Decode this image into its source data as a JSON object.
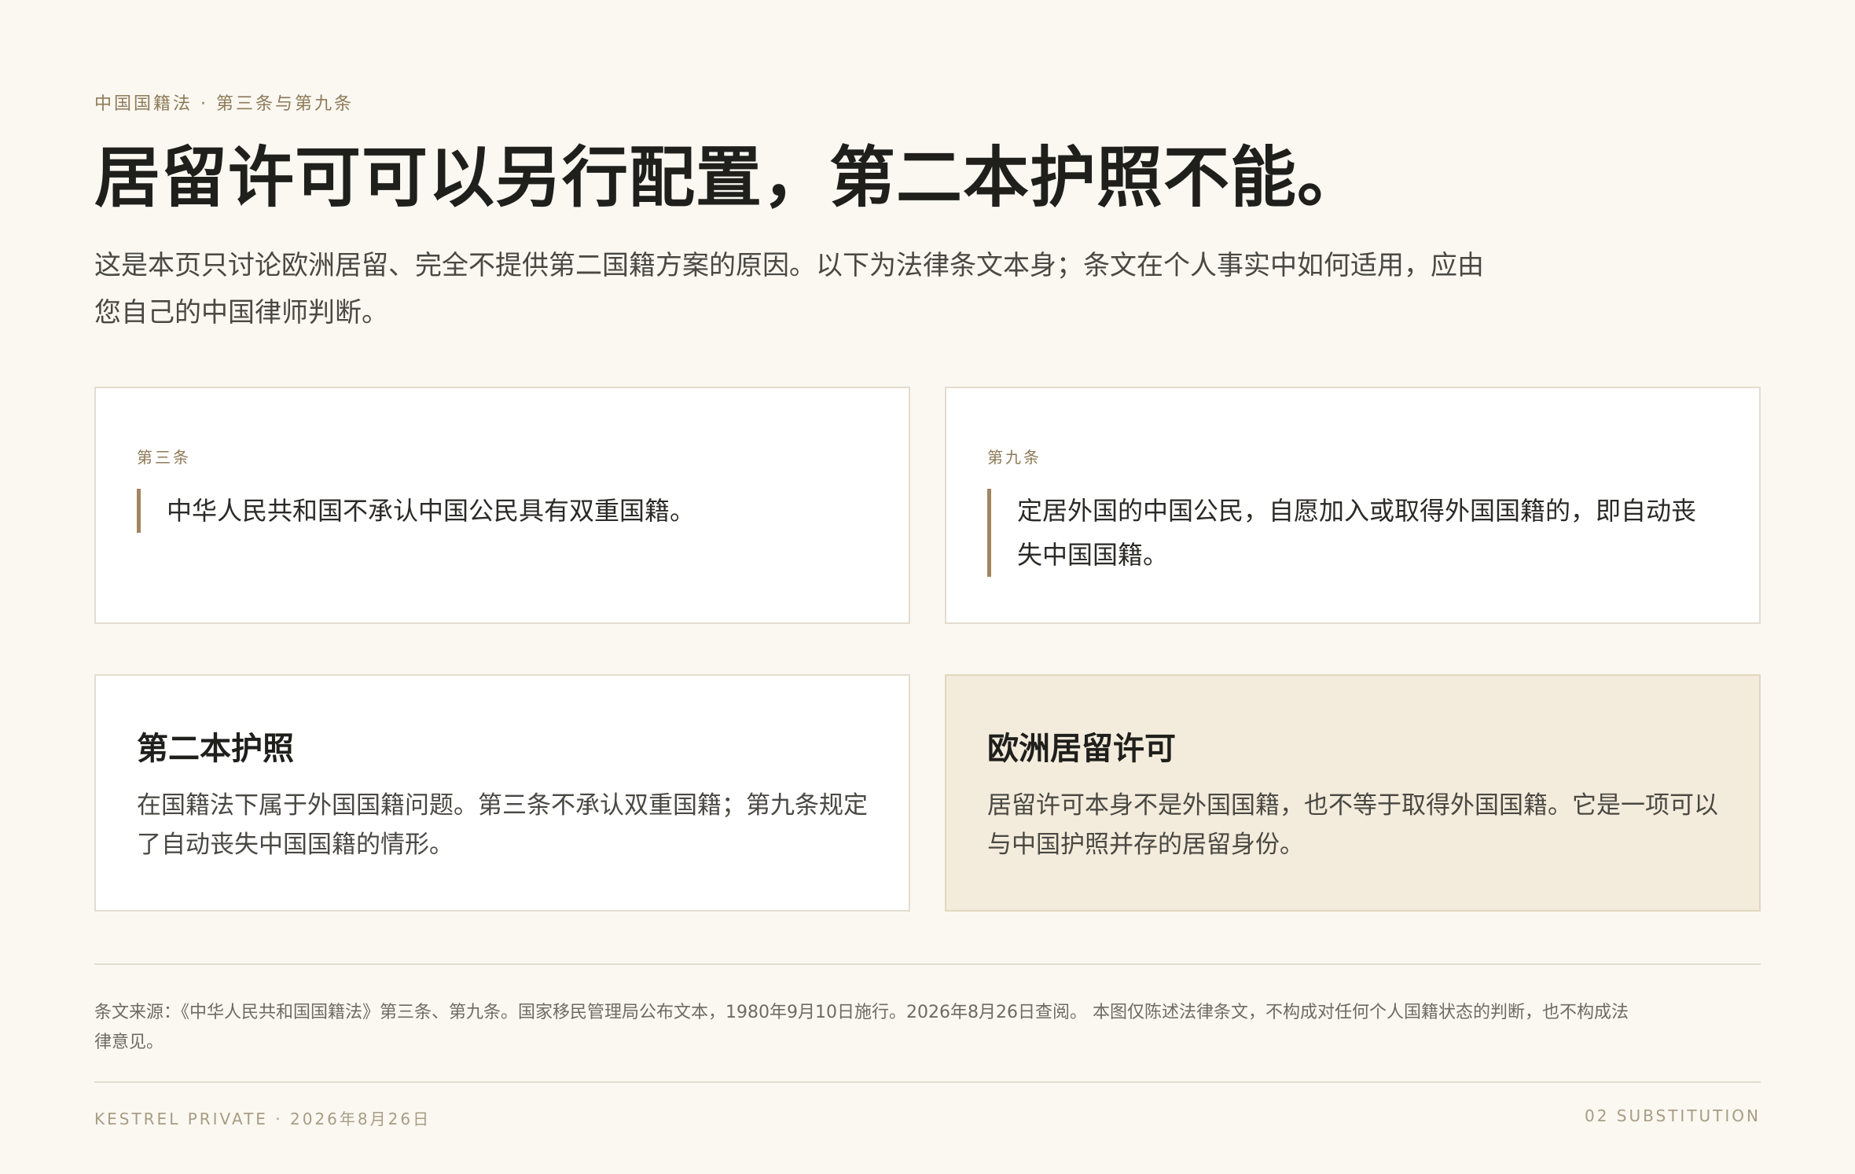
{
  "header": {
    "eyebrow": "中国国籍法 · 第三条与第九条",
    "title": "居留许可可以另行配置，第二本护照不能。",
    "lede": "这是本页只讨论欧洲居留、完全不提供第二国籍方案的原因。以下为法律条文本身；条文在个人事实中如何适用，应由您自己的中国律师判断。"
  },
  "articles": [
    {
      "label": "第三条",
      "text": "中华人民共和国不承认中国公民具有双重国籍。"
    },
    {
      "label": "第九条",
      "text": "定居外国的中国公民，自愿加入或取得外国国籍的，即自动丧失中国国籍。"
    }
  ],
  "comparison": [
    {
      "title": "第二本护照",
      "body": "在国籍法下属于外国国籍问题。第三条不承认双重国籍；第九条规定了自动丧失中国国籍的情形。"
    },
    {
      "title": "欧洲居留许可",
      "body": "居留许可本身不是外国国籍，也不等于取得外国国籍。它是一项可以与中国护照并存的居留身份。"
    }
  ],
  "source": {
    "text": "条文来源：《中华人民共和国国籍法》第三条、第九条。国家移民管理局公布文本，1980年9月10日施行。2026年8月26日查阅。 本图仅陈述法律条文，不构成对任何个人国籍状态的判断，也不构成法律意见。"
  },
  "footer": {
    "left": "KESTREL PRIVATE · 2026年8月26日",
    "right": "02 SUBSTITUTION"
  },
  "colors": {
    "background": "#faf8f1",
    "accent_gold": "#8e7a58",
    "quote_bar": "#a08660",
    "highlight_card": "#f3ecdc"
  }
}
